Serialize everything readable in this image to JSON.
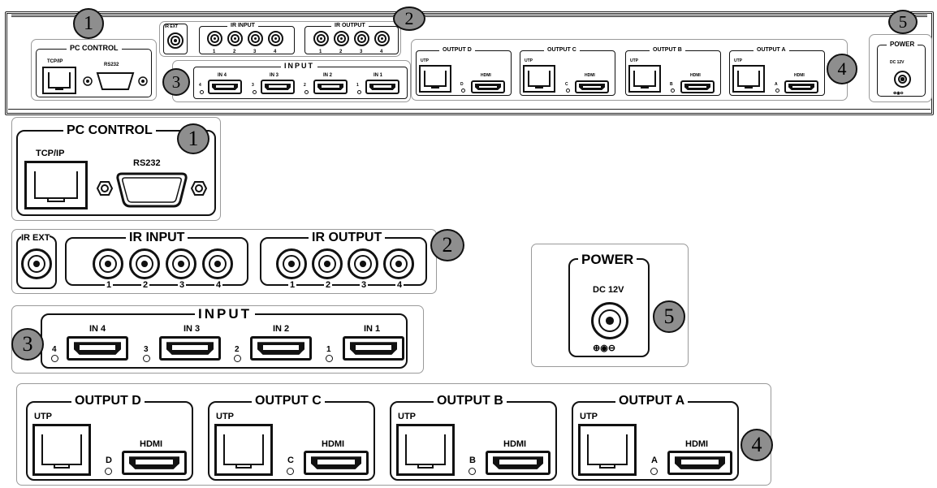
{
  "callouts": {
    "pc_control": "1",
    "ir": "2",
    "input": "3",
    "output": "4",
    "power": "5"
  },
  "pc_control": {
    "title": "PC CONTROL",
    "tcp_ip": "TCP/IP",
    "rs232": "RS232"
  },
  "ir": {
    "ir_ext": "IR EXT",
    "ir_input": "IR INPUT",
    "ir_output": "IR OUTPUT",
    "numbers": [
      "1",
      "2",
      "3",
      "4"
    ]
  },
  "input": {
    "title": "INPUT",
    "ports": [
      {
        "label": "IN 4",
        "led": "4"
      },
      {
        "label": "IN 3",
        "led": "3"
      },
      {
        "label": "IN 2",
        "led": "2"
      },
      {
        "label": "IN 1",
        "led": "1"
      }
    ]
  },
  "outputs": [
    {
      "title": "OUTPUT D",
      "utp": "UTP",
      "hdmi": "HDMI",
      "led": "D"
    },
    {
      "title": "OUTPUT C",
      "utp": "UTP",
      "hdmi": "HDMI",
      "led": "C"
    },
    {
      "title": "OUTPUT B",
      "utp": "UTP",
      "hdmi": "HDMI",
      "led": "B"
    },
    {
      "title": "OUTPUT A",
      "utp": "UTP",
      "hdmi": "HDMI",
      "led": "A"
    }
  ],
  "power": {
    "title": "POWER",
    "voltage": "DC 12V",
    "polarity": "⊕◉⊖"
  }
}
